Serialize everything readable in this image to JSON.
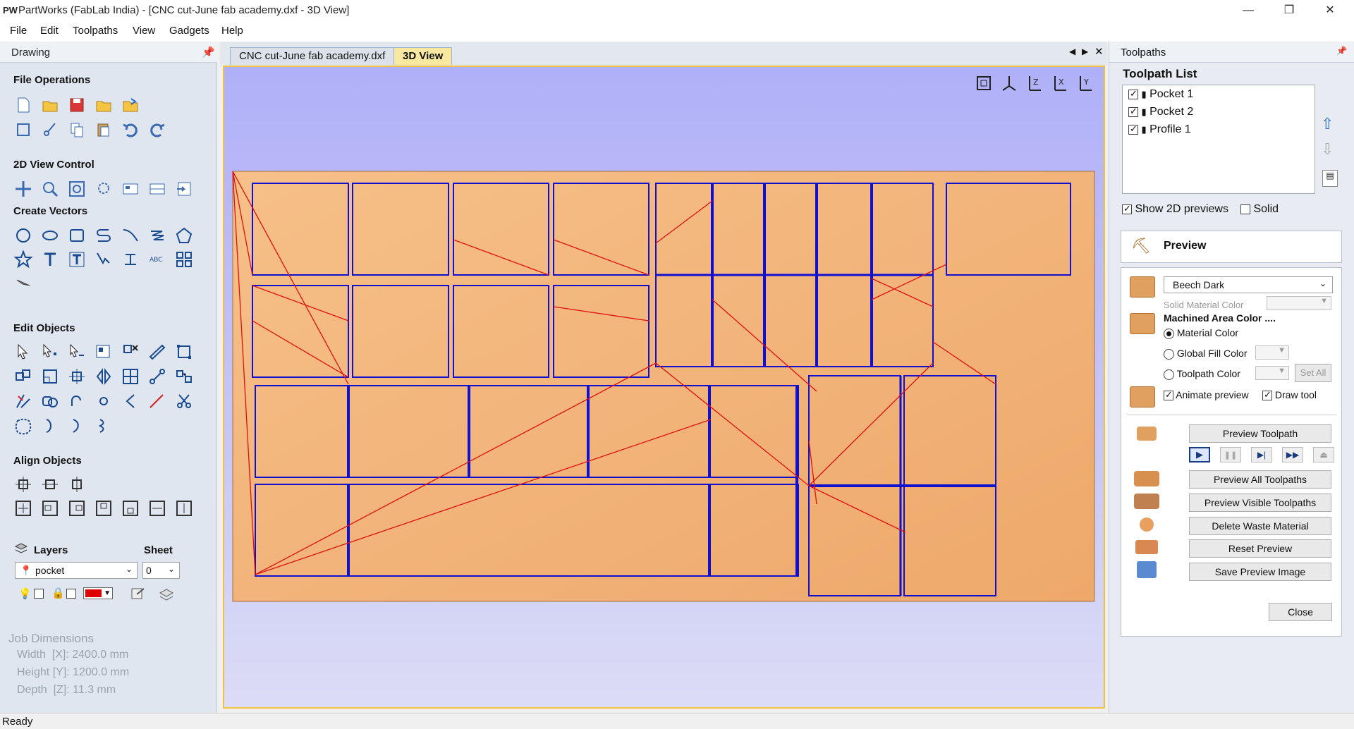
{
  "app": {
    "logo": "PW",
    "title": "PartWorks (FabLab India) - [CNC cut-June fab academy.dxf - 3D View]"
  },
  "menu": [
    "File",
    "Edit",
    "Toolpaths",
    "View",
    "Gadgets",
    "Help"
  ],
  "left": {
    "panel_title": "Drawing",
    "sections": {
      "file_ops": "File Operations",
      "view_ctrl": "2D View Control",
      "create_vectors": "Create Vectors",
      "edit_objects": "Edit Objects",
      "align_objects": "Align Objects"
    },
    "layers_label": "Layers",
    "sheet_label": "Sheet",
    "layer_value": "pocket",
    "sheet_value": "0",
    "layer_color": "#e00000",
    "job": {
      "title": "Job Dimensions",
      "width": "Width  [X]: 2400.0 mm",
      "height": "Height [Y]: 1200.0 mm",
      "depth": "Depth  [Z]: 11.3 mm"
    }
  },
  "tabs": [
    {
      "label": "CNC cut-June fab academy.dxf",
      "active": false
    },
    {
      "label": "3D View",
      "active": true
    }
  ],
  "right": {
    "panel_title": "Toolpaths",
    "list_title": "Toolpath List",
    "toolpaths": [
      "Pocket 1",
      "Pocket 2",
      "Profile 1"
    ],
    "show_2d": "Show 2D previews",
    "solid": "Solid",
    "preview_title": "Preview",
    "material": "Beech Dark",
    "solid_material_color": "Solid Material Color",
    "machined_title": "Machined Area Color ....",
    "material_color": "Material Color",
    "global_fill": "Global Fill Color",
    "toolpath_color": "Toolpath Color",
    "set_all": "Set All",
    "animate": "Animate preview",
    "draw_tool": "Draw tool",
    "buttons": {
      "preview_toolpath": "Preview Toolpath",
      "preview_all": "Preview All Toolpaths",
      "preview_visible": "Preview Visible Toolpaths",
      "delete_waste": "Delete Waste Material",
      "reset": "Reset Preview",
      "save_image": "Save Preview Image",
      "close": "Close"
    }
  },
  "status": "Ready",
  "colors": {
    "accent": "#f0c040",
    "board": "#f0b070",
    "vector": "#1010d0",
    "toolpath": "#e01010"
  }
}
